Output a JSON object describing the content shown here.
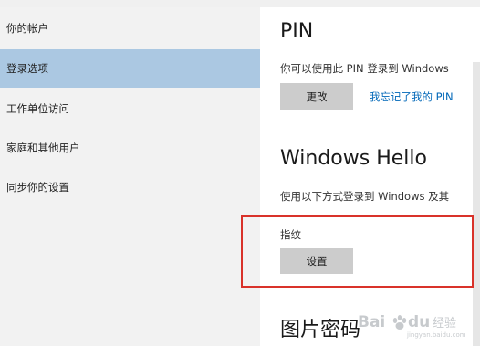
{
  "sidebar": {
    "items": [
      {
        "label": "你的帐户"
      },
      {
        "label": "登录选项"
      },
      {
        "label": "工作单位访问"
      },
      {
        "label": "家庭和其他用户"
      },
      {
        "label": "同步你的设置"
      }
    ]
  },
  "pin": {
    "heading": "PIN",
    "description": "你可以使用此 PIN 登录到 Windows",
    "change_label": "更改",
    "forgot_label": "我忘记了我的 PIN"
  },
  "hello": {
    "heading": "Windows Hello",
    "description": "使用以下方式登录到 Windows 及其",
    "fingerprint_label": "指纹",
    "setup_label": "设置"
  },
  "picture_password": {
    "heading": "图片密码"
  },
  "watermark": {
    "text": "Bai du 经验",
    "subtext": "jingyan.baidu.com"
  },
  "colors": {
    "selected": "#abc8e2",
    "link": "#0067b8",
    "highlight": "#d9322a",
    "button": "#cccccc"
  }
}
